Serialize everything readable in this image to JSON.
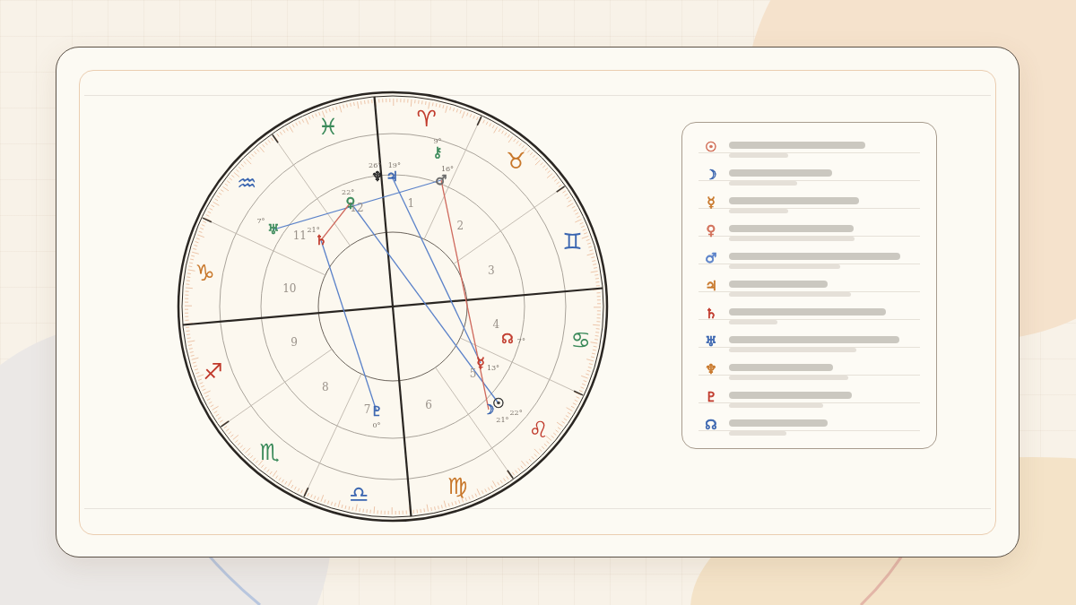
{
  "chart": {
    "signs": [
      {
        "glyph": "♈",
        "color": "#c0392b"
      },
      {
        "glyph": "♉",
        "color": "#c8772a"
      },
      {
        "glyph": "♊",
        "color": "#3a65b0"
      },
      {
        "glyph": "♋",
        "color": "#3b8a5a"
      },
      {
        "glyph": "♌",
        "color": "#c0392b"
      },
      {
        "glyph": "♍",
        "color": "#c8772a"
      },
      {
        "glyph": "♎",
        "color": "#3a65b0"
      },
      {
        "glyph": "♏",
        "color": "#3b8a5a"
      },
      {
        "glyph": "♐",
        "color": "#c0392b"
      },
      {
        "glyph": "♑",
        "color": "#c8772a"
      },
      {
        "glyph": "♒",
        "color": "#3a65b0"
      },
      {
        "glyph": "♓",
        "color": "#3b8a5a"
      }
    ],
    "houses": [
      "1",
      "12",
      "2",
      "11",
      "3",
      "10",
      "4",
      "9",
      "5",
      "8",
      "6",
      "7"
    ],
    "planets": [
      {
        "glyph": "⚷",
        "degree": "9°",
        "color": "#3b8a5a"
      },
      {
        "glyph": "♆",
        "degree": "26°",
        "color": "#222222"
      },
      {
        "glyph": "♃",
        "degree": "19°",
        "color": "#3a65b0"
      },
      {
        "glyph": "♂",
        "degree": "16°",
        "color": "#6a6a6a"
      },
      {
        "glyph": "♀",
        "degree": "22°",
        "color": "#3b8a5a"
      },
      {
        "glyph": "♅",
        "degree": "7°",
        "color": "#3b8a5a"
      },
      {
        "glyph": "♄",
        "degree": "21°",
        "color": "#c0392b"
      },
      {
        "glyph": "☊",
        "degree": "7°",
        "color": "#c0392b"
      },
      {
        "glyph": "☿",
        "degree": "13°",
        "color": "#c0392b"
      },
      {
        "glyph": "☉",
        "degree": "22°",
        "color": "#3a3a3a"
      },
      {
        "glyph": "♇",
        "degree": "0°",
        "color": "#3a65b0"
      },
      {
        "glyph": "☽",
        "degree": "21°",
        "color": "#3a65b0"
      }
    ],
    "aspects": [
      {
        "color": "#5b82c9"
      },
      {
        "color": "#5b82c9"
      },
      {
        "color": "#5b82c9"
      },
      {
        "color": "#5b82c9"
      },
      {
        "color": "#cf6a5e"
      },
      {
        "color": "#cf6a5e"
      }
    ]
  },
  "legend": [
    {
      "glyph": "☉",
      "color": "#d2705a"
    },
    {
      "glyph": "☽",
      "color": "#3a65b0"
    },
    {
      "glyph": "☿",
      "color": "#c8772a"
    },
    {
      "glyph": "♀",
      "color": "#d2705a"
    },
    {
      "glyph": "♂",
      "color": "#5b82c9"
    },
    {
      "glyph": "♃",
      "color": "#c8772a"
    },
    {
      "glyph": "♄",
      "color": "#c0392b"
    },
    {
      "glyph": "♅",
      "color": "#3a65b0"
    },
    {
      "glyph": "♆",
      "color": "#c8772a"
    },
    {
      "glyph": "♇",
      "color": "#c0392b"
    },
    {
      "glyph": "☊",
      "color": "#3a65b0"
    }
  ]
}
